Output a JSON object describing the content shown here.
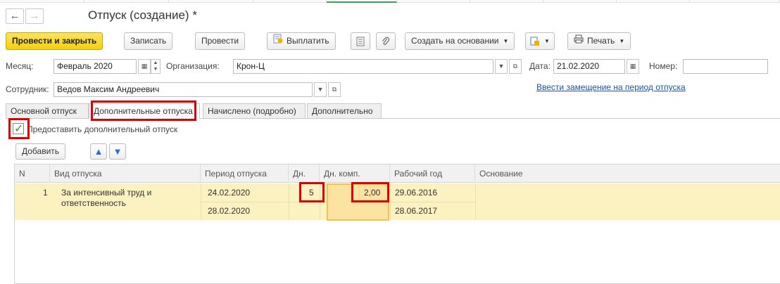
{
  "header": {
    "back_arrow": "←",
    "forward_arrow": "→",
    "title": "Отпуск (создание) *"
  },
  "toolbar": {
    "post_close": "Провести и закрыть",
    "save": "Записать",
    "post": "Провести",
    "pay": "Выплатить",
    "create_based": "Создать на основании",
    "print": "Печать"
  },
  "form": {
    "month_label": "Месяц:",
    "month_value": "Февраль 2020",
    "org_label": "Организация:",
    "org_value": "Крон-Ц",
    "date_label": "Дата:",
    "date_value": "21.02.2020",
    "number_label": "Номер:",
    "number_value": "",
    "employee_label": "Сотрудник:",
    "employee_value": "Ведов Максим Андреевич",
    "replacement_link": "Ввести замещение на период отпуска"
  },
  "tabs": [
    {
      "label": "Основной отпуск"
    },
    {
      "label": "Дополнительные отпуска"
    },
    {
      "label": "Начислено (подробно)"
    },
    {
      "label": "Дополнительно"
    }
  ],
  "extra_leave": {
    "checkbox_label": "Предоставить дополнительный отпуск",
    "checked": true,
    "add_button": "Добавить"
  },
  "table": {
    "columns": [
      "N",
      "Вид отпуска",
      "Период отпуска",
      "Дн.",
      "Дн. комп.",
      "Рабочий год",
      "Основание"
    ],
    "rows": [
      {
        "n": "1",
        "kind_line1": "За интенсивный труд и",
        "kind_line2": "ответственность",
        "period_start": "24.02.2020",
        "period_end": "28.02.2020",
        "days": "5",
        "comp_days": "2,00",
        "work_year_start": "29.06.2016",
        "work_year_end": "28.06.2017",
        "basis": ""
      }
    ]
  },
  "colors": {
    "primary_button": "#f3cf13",
    "highlight_red": "#e00000",
    "row_selected": "#fbf1c1",
    "link": "#1d51b3",
    "check": "#2e9a3b"
  }
}
